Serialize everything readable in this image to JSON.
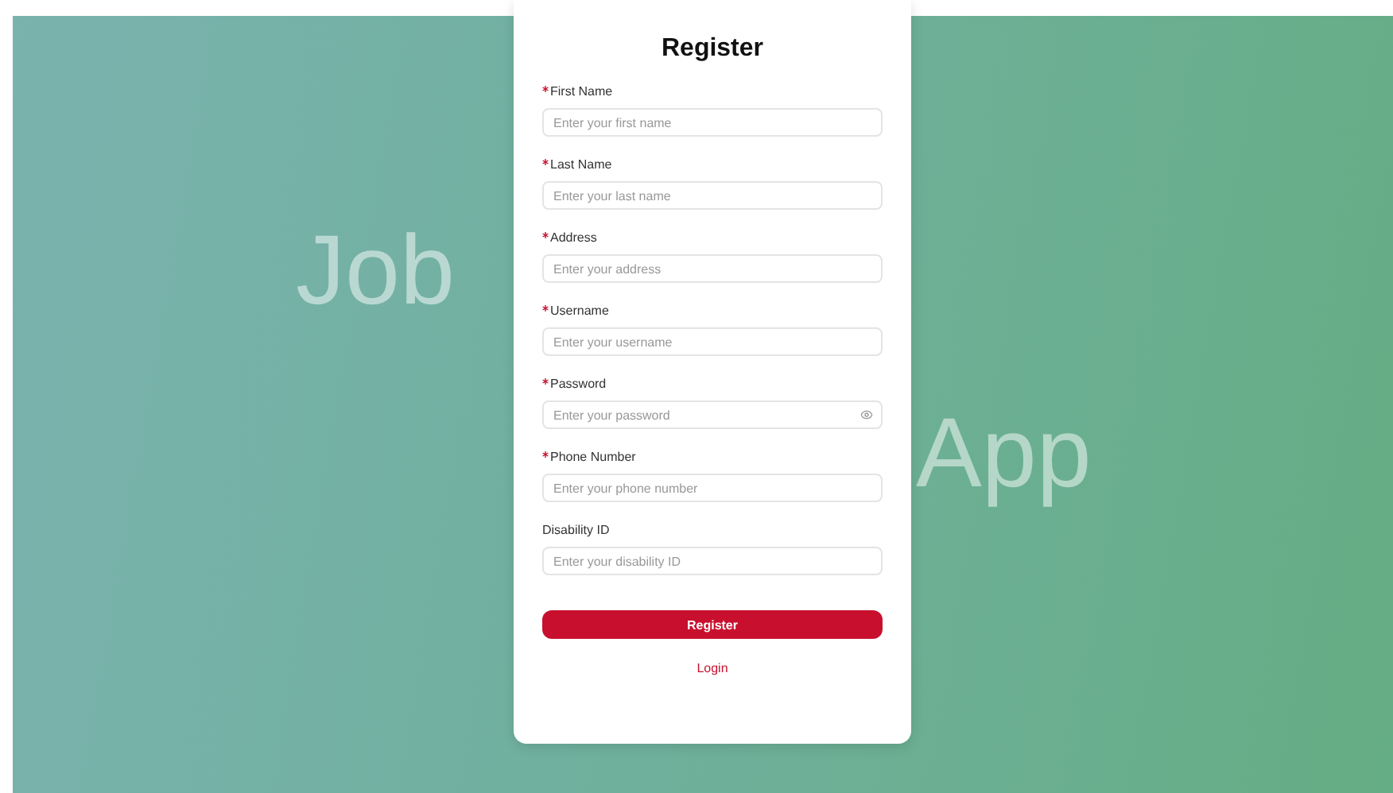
{
  "background_title": [
    "Job",
    "App"
  ],
  "form": {
    "title": "Register",
    "fields": [
      {
        "label": "First Name",
        "required": true,
        "kind": "text",
        "placeholder": "Enter your first name"
      },
      {
        "label": "Last Name",
        "required": true,
        "kind": "text",
        "placeholder": "Enter your last name"
      },
      {
        "label": "Address",
        "required": true,
        "kind": "text",
        "placeholder": "Enter your address"
      },
      {
        "label": "Username",
        "required": true,
        "kind": "text",
        "placeholder": "Enter your username"
      },
      {
        "label": "Password",
        "required": true,
        "kind": "password",
        "placeholder": "Enter your password"
      },
      {
        "label": "Phone Number",
        "required": true,
        "kind": "text",
        "placeholder": "Enter your phone number"
      },
      {
        "label": "Disability ID",
        "required": false,
        "kind": "text",
        "placeholder": "Enter your disability ID"
      }
    ],
    "submit": "Register",
    "login_link": "Login"
  }
}
